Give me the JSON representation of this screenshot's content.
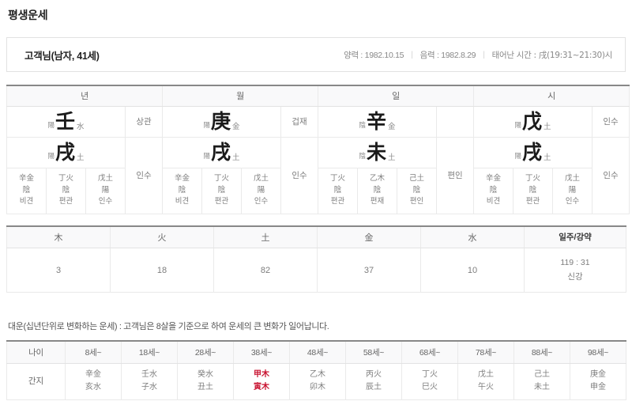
{
  "page": {
    "title": "평생운세"
  },
  "profile": {
    "name": "고객님(남자, 41세)",
    "solar_label": "양력 : 1982.10.15",
    "lunar_label": "음력 : 1982.8.29",
    "birth_time_label": "태어난 시간 : 戌(19:31~21:30)시",
    "separator": "|"
  },
  "saju": {
    "pillar_headers": [
      "년",
      "월",
      "일",
      "시"
    ],
    "pillars": [
      {
        "key": "year",
        "header": "년",
        "stem": {
          "yin_yang": "陽",
          "char": "壬",
          "element": "水"
        },
        "branch": {
          "yin_yang": "陽",
          "char": "戌",
          "element": "土"
        },
        "stem_god": "상관",
        "branch_god": "인수",
        "hidden_stems": [
          {
            "stem": "辛金",
            "yin_yang": "陰",
            "god": "비견"
          },
          {
            "stem": "丁火",
            "yin_yang": "陰",
            "god": "편관"
          },
          {
            "stem": "戊土",
            "yin_yang": "陽",
            "god": "인수"
          }
        ]
      },
      {
        "key": "month",
        "header": "월",
        "stem": {
          "yin_yang": "陽",
          "char": "庚",
          "element": "金"
        },
        "branch": {
          "yin_yang": "陽",
          "char": "戌",
          "element": "土"
        },
        "stem_god": "겁재",
        "branch_god": "인수",
        "hidden_stems": [
          {
            "stem": "辛金",
            "yin_yang": "陰",
            "god": "비견"
          },
          {
            "stem": "丁火",
            "yin_yang": "陰",
            "god": "편관"
          },
          {
            "stem": "戊土",
            "yin_yang": "陽",
            "god": "인수"
          }
        ]
      },
      {
        "key": "day",
        "header": "일",
        "stem": {
          "yin_yang": "陰",
          "char": "辛",
          "element": "金"
        },
        "branch": {
          "yin_yang": "陰",
          "char": "未",
          "element": "土"
        },
        "stem_god": "",
        "branch_god": "편인",
        "hidden_stems": [
          {
            "stem": "丁火",
            "yin_yang": "陰",
            "god": "편관"
          },
          {
            "stem": "乙木",
            "yin_yang": "陰",
            "god": "편재"
          },
          {
            "stem": "己土",
            "yin_yang": "陰",
            "god": "편인"
          }
        ]
      },
      {
        "key": "hour",
        "header": "시",
        "stem": {
          "yin_yang": "陽",
          "char": "戊",
          "element": "土"
        },
        "branch": {
          "yin_yang": "陽",
          "char": "戌",
          "element": "土"
        },
        "stem_god": "인수",
        "branch_god": "인수",
        "hidden_stems": [
          {
            "stem": "辛金",
            "yin_yang": "陰",
            "god": "비견"
          },
          {
            "stem": "丁火",
            "yin_yang": "陰",
            "god": "편관"
          },
          {
            "stem": "戊土",
            "yin_yang": "陽",
            "god": "인수"
          }
        ]
      }
    ]
  },
  "elements": {
    "headers": [
      "木",
      "火",
      "土",
      "金",
      "水"
    ],
    "values": [
      "3",
      "18",
      "82",
      "37",
      "10"
    ],
    "strength_header": "일주/강약",
    "strength_ratio": "119 : 31",
    "strength_label": "신강"
  },
  "daeun": {
    "description": "대운(십년단위로 변화하는 운세) : 고객님은 8살을 기준으로 하여 운세의 큰 변화가 일어납니다.",
    "age_row_label": "나이",
    "ganji_row_label": "간지",
    "ages": [
      "8세~",
      "18세~",
      "28세~",
      "38세~",
      "48세~",
      "58세~",
      "68세~",
      "78세~",
      "88세~",
      "98세~"
    ],
    "ganji": [
      {
        "stem": "辛金",
        "branch": "亥水",
        "highlight": false
      },
      {
        "stem": "壬水",
        "branch": "子水",
        "highlight": false
      },
      {
        "stem": "癸水",
        "branch": "丑土",
        "highlight": false
      },
      {
        "stem": "甲木",
        "branch": "寅木",
        "highlight": true
      },
      {
        "stem": "乙木",
        "branch": "卯木",
        "highlight": false
      },
      {
        "stem": "丙火",
        "branch": "辰土",
        "highlight": false
      },
      {
        "stem": "丁火",
        "branch": "巳火",
        "highlight": false
      },
      {
        "stem": "戊土",
        "branch": "午火",
        "highlight": false
      },
      {
        "stem": "己土",
        "branch": "未土",
        "highlight": false
      },
      {
        "stem": "庚金",
        "branch": "申金",
        "highlight": false
      }
    ],
    "highlight_color": "#c8102e"
  }
}
